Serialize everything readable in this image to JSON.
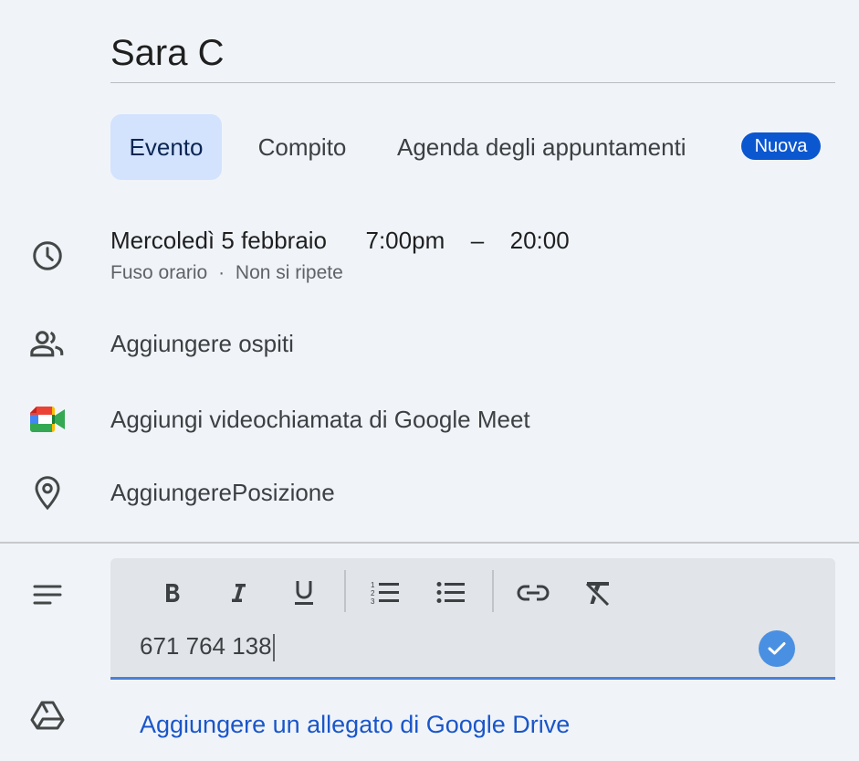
{
  "event": {
    "title": "Sara C"
  },
  "tabs": [
    {
      "label": "Evento",
      "active": true
    },
    {
      "label": "Compito",
      "active": false
    },
    {
      "label": "Agenda degli appuntamenti",
      "active": false,
      "badge": "Nuova"
    }
  ],
  "datetime": {
    "date": "Mercoledì 5 febbraio",
    "start": "7:00pm",
    "separator": "–",
    "end": "20:00",
    "timezone": "Fuso orario",
    "dot": "·",
    "recurrence": "Non si ripete"
  },
  "rows": {
    "guests": "Aggiungere ospiti",
    "meet": "Aggiungi videochiamata di Google Meet",
    "location": "AggiungerePosizione"
  },
  "description": {
    "text": "671 764 138",
    "toolbar": [
      "bold-icon",
      "italic-icon",
      "underline-icon",
      "numbered-list-icon",
      "bulleted-list-icon",
      "link-icon",
      "clear-formatting-icon"
    ]
  },
  "attachment": {
    "label": "Aggiungere un allegato di Google Drive"
  },
  "colors": {
    "background": "#f0f4f9",
    "active_tab": "#d3e3fd",
    "badge": "#0b57d0",
    "link": "#1a56c9",
    "editor_underline": "#4a7fdb"
  }
}
